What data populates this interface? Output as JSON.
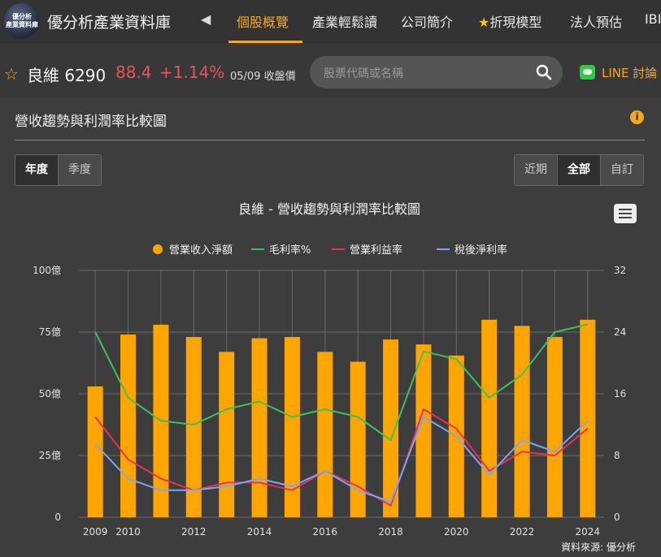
{
  "nav": {
    "logo_line1": "優分析",
    "logo_line2": "產業資料庫",
    "brand": "優分析產業資料庫",
    "items": [
      {
        "label": "個股概覽",
        "active": true
      },
      {
        "label": "產業輕鬆讀",
        "active": false
      },
      {
        "label": "公司簡介",
        "active": false
      },
      {
        "label": "折現模型",
        "active": false
      },
      {
        "label": "法人預估",
        "active": false
      },
      {
        "label": "IBI",
        "active": false
      }
    ]
  },
  "stock": {
    "name": "良維 6290",
    "price": "88.4",
    "change": "+1.14%",
    "date": "05/09 收盤價"
  },
  "search": {
    "placeholder": "股票代碼或名稱"
  },
  "line_discuss": "LINE 討論",
  "panel": {
    "title": "營收趨勢與利潤率比較圖",
    "period_tabs": [
      {
        "label": "年度",
        "on": true
      },
      {
        "label": "季度",
        "on": false
      }
    ],
    "range_tabs": [
      {
        "label": "近期",
        "on": false
      },
      {
        "label": "全部",
        "on": true
      },
      {
        "label": "自訂",
        "on": false
      }
    ]
  },
  "colors": {
    "accent": "#f5a623",
    "bar": "#ffa500",
    "gross": "#3fbf5f",
    "op": "#e8305a",
    "net": "#7aa7f5",
    "down": "#f0505a"
  },
  "chart_data": {
    "type": "bar",
    "title": "良維 - 營收趨勢與利潤率比較圖",
    "source": "資料來源: 優分析",
    "x": [
      2009,
      2010,
      2011,
      2012,
      2013,
      2014,
      2015,
      2016,
      2017,
      2018,
      2019,
      2020,
      2021,
      2022,
      2023,
      2024
    ],
    "x_tick_labels": [
      "2009",
      "2010",
      "2012",
      "2014",
      "2016",
      "2018",
      "2020",
      "2022",
      "2024"
    ],
    "y_left": {
      "ylim": [
        0,
        100
      ],
      "ticks": [
        "0",
        "25億",
        "50億",
        "75億",
        "100億"
      ]
    },
    "y_right": {
      "ylim": [
        0,
        32
      ],
      "ticks": [
        "0",
        "8",
        "16",
        "24",
        "32"
      ]
    },
    "series": [
      {
        "name": "營業收入淨額",
        "kind": "bar",
        "axis": "left",
        "values": [
          53,
          74,
          78,
          73,
          67,
          72.5,
          73,
          67,
          63,
          72,
          70,
          65.5,
          80,
          77.5,
          73,
          80
        ]
      },
      {
        "name": "毛利率%",
        "kind": "line",
        "axis": "right",
        "values": [
          24,
          15.5,
          12.5,
          12,
          14,
          15,
          13,
          14,
          13,
          10,
          21.5,
          20.5,
          15.5,
          18.5,
          24,
          25
        ]
      },
      {
        "name": "營業利益率",
        "kind": "line",
        "axis": "right",
        "values": [
          13,
          7.5,
          5,
          3.5,
          4.5,
          4.5,
          3.5,
          6,
          4,
          1.5,
          14,
          11.5,
          6,
          8.5,
          8,
          11.5
        ]
      },
      {
        "name": "稅後淨利率",
        "kind": "line",
        "axis": "right",
        "values": [
          9.5,
          5,
          3.5,
          3.5,
          4,
          5,
          4,
          6,
          3.5,
          2,
          13,
          10.5,
          5.5,
          10,
          8.5,
          12.5
        ]
      }
    ]
  }
}
